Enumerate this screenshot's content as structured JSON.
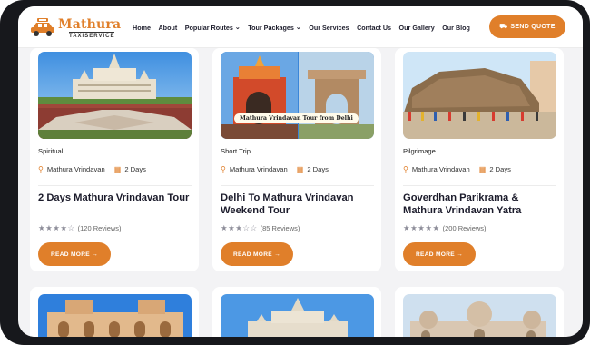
{
  "brand": {
    "name": "Mathura",
    "tagline": "TAXISERVICE",
    "accent": "#e07f2a"
  },
  "nav": [
    {
      "label": "Home",
      "dropdown": false
    },
    {
      "label": "About",
      "dropdown": false
    },
    {
      "label": "Popular Routes",
      "dropdown": true
    },
    {
      "label": "Tour Packages",
      "dropdown": true
    },
    {
      "label": "Our Services",
      "dropdown": false
    },
    {
      "label": "Contact Us",
      "dropdown": false
    },
    {
      "label": "Our Gallery",
      "dropdown": false
    },
    {
      "label": "Our Blog",
      "dropdown": false
    }
  ],
  "quote_button": {
    "label": "SEND QUOTE",
    "icon": "car-icon"
  },
  "cards": [
    {
      "category": "Spiritual",
      "location": "Mathura Vrindavan",
      "duration": "2 Days",
      "title": "2 Days Mathura Vrindavan Tour",
      "rating": 4.5,
      "reviews": "(120 Reviews)",
      "button": "READ MORE →",
      "image_caption": ""
    },
    {
      "category": "Short Trip",
      "location": "Mathura Vrindavan",
      "duration": "2 Days",
      "title": "Delhi To Mathura Vrindavan Weekend Tour",
      "rating": 3.5,
      "reviews": "(85 Reviews)",
      "button": "READ MORE →",
      "image_caption": "Mathura Vrindavan Tour from Delhi"
    },
    {
      "category": "Pilgrimage",
      "location": "Mathura Vrindavan",
      "duration": "2 Days",
      "title": "Goverdhan Parikrama & Mathura Vrindavan Yatra",
      "rating": 5,
      "reviews": "(200 Reviews)",
      "button": "READ MORE →",
      "image_caption": ""
    }
  ],
  "icons": {
    "location": "map-pin-icon",
    "duration": "calendar-icon",
    "rating": "star-icon"
  }
}
